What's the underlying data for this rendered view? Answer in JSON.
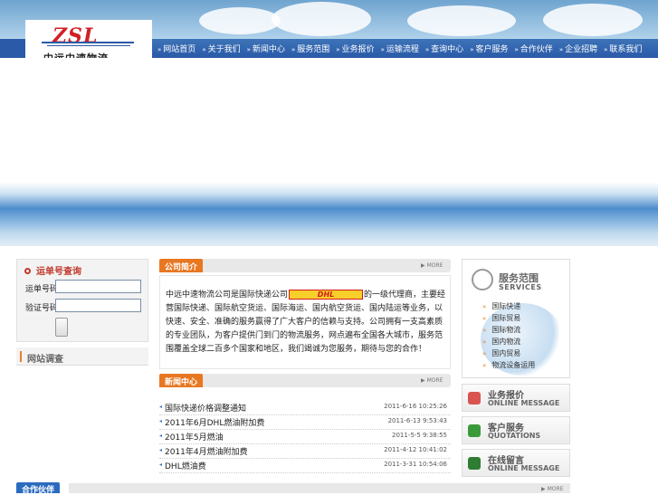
{
  "header": {
    "logo_text": "ZSL",
    "company_name": "中远中速物流"
  },
  "nav": {
    "items": [
      "网站首页",
      "关于我们",
      "新闻中心",
      "服务范围",
      "业务报价",
      "运输流程",
      "查询中心",
      "客户服务",
      "合作伙伴",
      "企业招聘",
      "联系我们"
    ]
  },
  "tracking": {
    "title": "运单号查询",
    "field1_label": "运单号码",
    "field1_value": "",
    "field2_label": "验证号码",
    "field2_value": ""
  },
  "survey": {
    "title": "网站调查"
  },
  "intro": {
    "tab": "公司简介",
    "more": "MORE",
    "text_before": "中远中速物流公司是国际快递公司",
    "dhl_logo": "DHL",
    "text_after": "的一级代理商，主要经营国际快递、国际航空货运、国际海运、国内航空货运、国内陆运等业务，以快速、安全、准确的服务赢得了广大客户的信赖与支持。公司拥有一支高素质的专业团队，为客户提供门到门的物流服务，网点遍布全国各大城市，服务范围覆盖全球二百多个国家和地区，我们竭诚为您服务，期待与您的合作！"
  },
  "news": {
    "tab": "新闻中心",
    "more": "MORE",
    "items": [
      {
        "title": "国际快递价格调整通知",
        "date": "2011-6-16 10:25:26"
      },
      {
        "title": "2011年6月DHL燃油附加费",
        "date": "2011-6-13 9:53:43"
      },
      {
        "title": "2011年5月燃油",
        "date": "2011-5-5 9:38:55"
      },
      {
        "title": "2011年4月燃油附加费",
        "date": "2011-4-12 10:41:02"
      },
      {
        "title": "DHL燃油费",
        "date": "2011-3-31 10:54:06"
      }
    ]
  },
  "services": {
    "title": "服务范围",
    "subtitle": "SERVICES",
    "items": [
      "国际快递",
      "国际贸易",
      "国际物流",
      "国内物流",
      "国内贸易",
      "物流设备运用"
    ]
  },
  "right_buttons": [
    {
      "cn": "业务报价",
      "en": "ONLINE MESSAGE",
      "color": "#d9534f"
    },
    {
      "cn": "客户服务",
      "en": "QUOTATIONS",
      "color": "#3a9a3a"
    },
    {
      "cn": "在线留言",
      "en": "ONLINE MESSAGE",
      "color": "#2e7d32"
    }
  ],
  "partners": {
    "tab": "合作伙伴",
    "more": "MORE"
  }
}
